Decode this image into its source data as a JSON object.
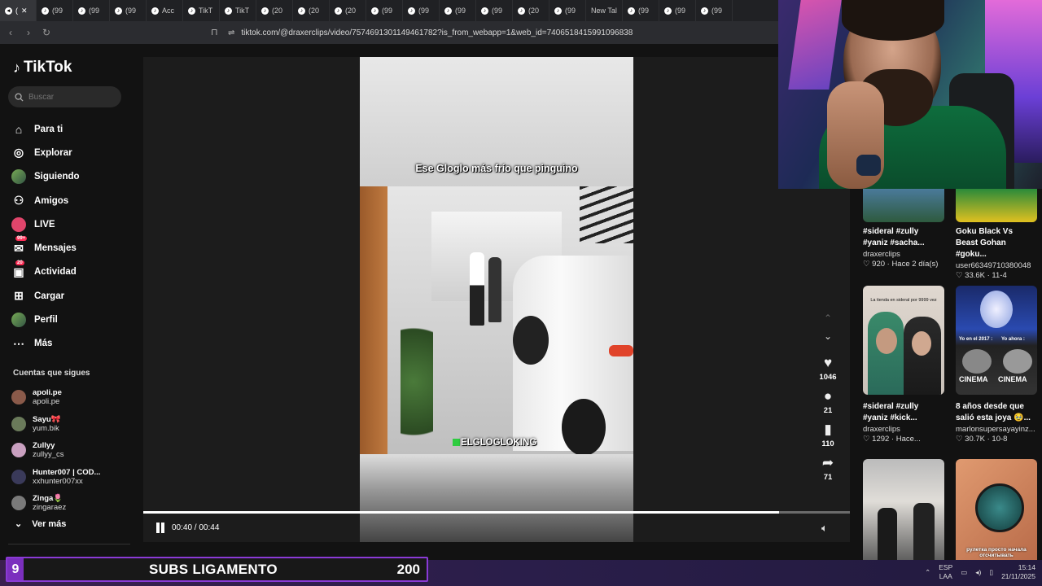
{
  "browser": {
    "tabs": [
      {
        "label": "(",
        "icon": "speaker-icon"
      },
      {
        "label": "(99",
        "icon": "tiktok-icon"
      },
      {
        "label": "(99",
        "icon": "tiktok-icon"
      },
      {
        "label": "(99",
        "icon": "tiktok-icon"
      },
      {
        "label": "Acc",
        "icon": "tiktok-icon"
      },
      {
        "label": "TikT",
        "icon": "tiktok-icon"
      },
      {
        "label": "TikT",
        "icon": "tiktok-icon"
      },
      {
        "label": "(20",
        "icon": "tiktok-icon"
      },
      {
        "label": "(20",
        "icon": "tiktok-icon"
      },
      {
        "label": "(20",
        "icon": "tiktok-icon"
      },
      {
        "label": "(99",
        "icon": "tiktok-icon"
      },
      {
        "label": "(99",
        "icon": "tiktok-icon"
      },
      {
        "label": "(99",
        "icon": "tiktok-icon"
      },
      {
        "label": "(99",
        "icon": "tiktok-icon"
      },
      {
        "label": "(20",
        "icon": "tiktok-icon"
      },
      {
        "label": "(99",
        "icon": "tiktok-icon"
      },
      {
        "label": "New Tal",
        "icon": ""
      },
      {
        "label": "(99",
        "icon": "tiktok-icon"
      },
      {
        "label": "(99",
        "icon": "tiktok-icon"
      },
      {
        "label": "(99",
        "icon": "tiktok-icon"
      }
    ],
    "url": "tiktok.com/@draxerclips/video/7574691301149461782?is_from_webapp=1&web_id=7406518415991096838"
  },
  "sidebar": {
    "logo": "TikTok",
    "search_placeholder": "Buscar",
    "menu": [
      {
        "label": "Para ti",
        "icon": "home-icon"
      },
      {
        "label": "Explorar",
        "icon": "compass-icon"
      },
      {
        "label": "Siguiendo",
        "icon": "following-avatar"
      },
      {
        "label": "Amigos",
        "icon": "friends-icon"
      },
      {
        "label": "LIVE",
        "icon": "live-icon"
      },
      {
        "label": "Mensajes",
        "icon": "message-icon",
        "badge": "99+"
      },
      {
        "label": "Actividad",
        "icon": "activity-icon",
        "badge": "20"
      },
      {
        "label": "Cargar",
        "icon": "upload-icon"
      },
      {
        "label": "Perfil",
        "icon": "profile-avatar"
      },
      {
        "label": "Más",
        "icon": "more-icon"
      }
    ],
    "following_title": "Cuentas que sigues",
    "following": [
      {
        "name": "apoli.pe",
        "handle": "apoli.pe"
      },
      {
        "name": "Sayu🎀",
        "handle": "yum.bik"
      },
      {
        "name": "Zullyy",
        "handle": "zullyy_cs"
      },
      {
        "name": "Hunter007 | COD...",
        "handle": "xxhunter007xx"
      },
      {
        "name": "Zinga🌷",
        "handle": "zingaraez"
      }
    ],
    "see_more": "Ver más"
  },
  "video": {
    "caption": "Ese Gloglo más frío que pinguino",
    "watermark": "ELGLOGLOKING",
    "time": "00:40 / 00:44",
    "progress": 0.9,
    "likes": "1046",
    "comments": "21",
    "saves": "110",
    "shares": "71"
  },
  "recommendations": [
    {
      "title": "#sideral #zully #yaniz #sacha...",
      "author": "draxerclips",
      "meta": "♡ 920 · Hace 2 día(s)"
    },
    {
      "title": "Goku Black Vs Beast Gohan #goku...",
      "author": "user66349710380048",
      "meta": "♡ 33.6K · 11-4"
    },
    {
      "title": "#sideral #zully #yaniz #kick...",
      "author": "draxerclips",
      "meta": "♡ 1292 · Hace..."
    },
    {
      "title": "8 años desde que salió esta joya 🥹...",
      "author": "marlonsupersayayinz...",
      "meta": "♡ 30.7K · 10-8"
    }
  ],
  "rec_thumb_texts": {
    "t3_top": "La tienda en sideral por 9999 vez",
    "t4_left": "Yo en el 2017 :",
    "t4_right": "Yo ahora :",
    "t4_word": "CINEMA",
    "t6_caption": "рулетка просто начала отсчитывать"
  },
  "stream_overlay": {
    "number": "9",
    "title": "SUBS LIGAMENTO",
    "count": "200"
  },
  "taskbar": {
    "lang": "ESP",
    "lang_sub": "LAA",
    "time": "15:14",
    "date": "21/11/2025"
  }
}
